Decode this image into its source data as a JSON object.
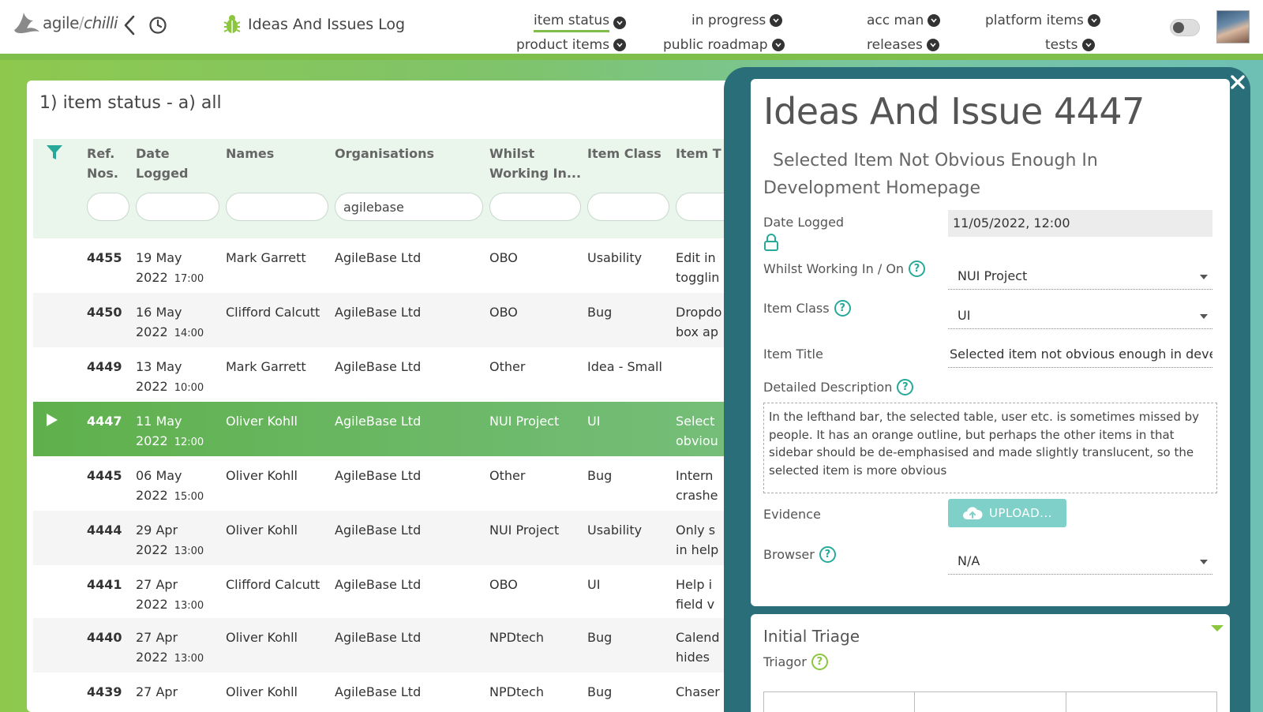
{
  "app": {
    "logo_word1": "agile",
    "logo_slash": "/",
    "logo_word2": "chilli",
    "title": "Ideas And Issues Log"
  },
  "nav": {
    "row1": [
      "item status",
      "in progress",
      "acc man",
      "platform items"
    ],
    "row2": [
      "product items",
      "public roadmap",
      "releases",
      "tests"
    ],
    "active": "item status"
  },
  "view": {
    "title": "1) item status - a) all"
  },
  "table": {
    "headers": [
      [
        "Ref.",
        "Nos."
      ],
      [
        "Date",
        "Logged"
      ],
      [
        "Names",
        ""
      ],
      [
        "Organisations",
        ""
      ],
      [
        "Whilst",
        "Working In..."
      ],
      [
        "Item Class",
        ""
      ],
      [
        "Item T",
        ""
      ]
    ],
    "filters": [
      "",
      "",
      "",
      "agilebase",
      "",
      "",
      ""
    ],
    "rows": [
      {
        "ref": "4455",
        "date1": "19 May",
        "date2": "2022",
        "time": "17:00",
        "name": "Mark Garrett",
        "org": "AgileBase Ltd",
        "whilst": "OBO",
        "cls": "Usability",
        "t1": "Edit in",
        "t2": "togglin"
      },
      {
        "ref": "4450",
        "date1": "16 May",
        "date2": "2022",
        "time": "14:00",
        "name": "Clifford Calcutt",
        "org": "AgileBase Ltd",
        "whilst": "OBO",
        "cls": "Bug",
        "t1": "Dropdo",
        "t2": "box ap"
      },
      {
        "ref": "4449",
        "date1": "13 May",
        "date2": "2022",
        "time": "10:00",
        "name": "Mark Garrett",
        "org": "AgileBase Ltd",
        "whilst": "Other",
        "cls": "Idea - Small",
        "t1": "",
        "t2": ""
      },
      {
        "ref": "4447",
        "date1": "11 May",
        "date2": "2022",
        "time": "12:00",
        "name": "Oliver Kohll",
        "org": "AgileBase Ltd",
        "whilst": "NUI Project",
        "cls": "UI",
        "t1": "Select",
        "t2": "obviou"
      },
      {
        "ref": "4445",
        "date1": "06 May",
        "date2": "2022",
        "time": "15:00",
        "name": "Oliver Kohll",
        "org": "AgileBase Ltd",
        "whilst": "Other",
        "cls": "Bug",
        "t1": "Intern",
        "t2": "crashe"
      },
      {
        "ref": "4444",
        "date1": "29 Apr",
        "date2": "2022",
        "time": "13:00",
        "name": "Oliver Kohll",
        "org": "AgileBase Ltd",
        "whilst": "NUI Project",
        "cls": "Usability",
        "t1": "Only s",
        "t2": "in help"
      },
      {
        "ref": "4441",
        "date1": "27 Apr",
        "date2": "2022",
        "time": "13:00",
        "name": "Clifford Calcutt",
        "org": "AgileBase Ltd",
        "whilst": "OBO",
        "cls": "UI",
        "t1": "Help i",
        "t2": "field v"
      },
      {
        "ref": "4440",
        "date1": "27 Apr",
        "date2": "2022",
        "time": "13:00",
        "name": "Oliver Kohll",
        "org": "AgileBase Ltd",
        "whilst": "NPDtech",
        "cls": "Bug",
        "t1": "Calend",
        "t2": "hides"
      },
      {
        "ref": "4439",
        "date1": "27 Apr",
        "date2": "",
        "time": "",
        "name": "Oliver Kohll",
        "org": "AgileBase Ltd",
        "whilst": "NPDtech",
        "cls": "Bug",
        "t1": "Chaser",
        "t2": ""
      }
    ]
  },
  "record": {
    "title": "Ideas And Issue 4447",
    "subtitle": "Selected Item Not Obvious Enough In Development Homepage",
    "date_logged_label": "Date Logged",
    "date_logged_value": "11/05/2022, 12:00",
    "whilst_label": "Whilst Working In / On",
    "whilst_value": "NUI Project",
    "item_class_label": "Item Class",
    "item_class_value": "UI",
    "item_title_label": "Item Title",
    "item_title_value": "Selected item not obvious enough in development homepage",
    "desc_label": "Detailed Description",
    "desc_value": "In the lefthand bar, the selected table, user etc. is sometimes missed by people. It has an orange outline, but perhaps the other items in that sidebar should be de-emphasised and made slightly translucent, so the selected item is more obvious",
    "evidence_label": "Evidence",
    "upload_label": "UPLOAD...",
    "browser_label": "Browser",
    "browser_value": "N/A",
    "help_glyph": "?"
  },
  "triage": {
    "title": "Initial Triage",
    "triagor_label": "Triagor"
  },
  "colors": {
    "accent_green": "#7dbf4a",
    "panel_teal": "#2a6e7a",
    "help_teal": "#27a99a"
  },
  "icons": [
    "bird-logo-icon",
    "back-chevron-icon",
    "history-icon",
    "bug-icon",
    "chevron-down-icon",
    "filter-icon",
    "play-icon",
    "close-icon",
    "lock-icon",
    "help-icon",
    "upload-cloud-icon",
    "caret-down-icon"
  ]
}
